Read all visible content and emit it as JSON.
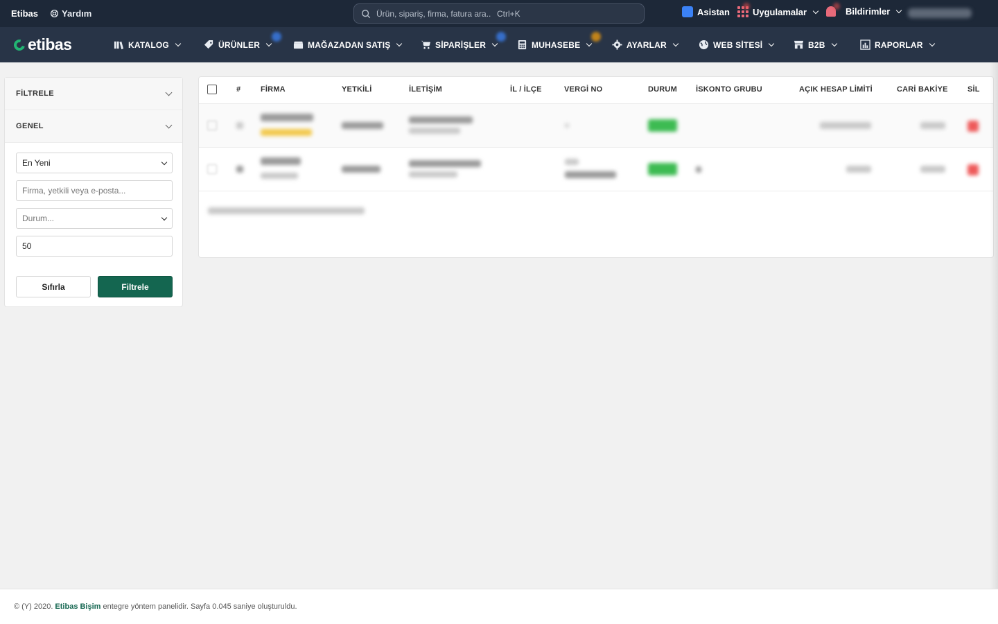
{
  "topbar": {
    "brand": "Etibas",
    "help_label": "Yardım",
    "search_placeholder": "Ürün, sipariş, firma, fatura ara...",
    "search_shortcut": "Ctrl+K",
    "assistant_label": "Asistan",
    "apps_label": "Uygulamalar",
    "notifications_label": "Bildirimler"
  },
  "navbar": {
    "logo": "etibas",
    "items": [
      {
        "label": "KATALOG",
        "icon": "books-icon"
      },
      {
        "label": "ÜRÜNLER",
        "icon": "tag-icon"
      },
      {
        "label": "MAĞAZADAN SATIŞ",
        "icon": "store-icon"
      },
      {
        "label": "SİPARİŞLER",
        "icon": "cart-icon"
      },
      {
        "label": "MUHASEBE",
        "icon": "calculator-icon"
      },
      {
        "label": "AYARLAR",
        "icon": "gear-icon"
      },
      {
        "label": "WEB SİTESİ",
        "icon": "globe-icon"
      },
      {
        "label": "B2B",
        "icon": "shop-icon"
      },
      {
        "label": "RAPORLAR",
        "icon": "chart-icon"
      }
    ]
  },
  "sidebar": {
    "filter_title": "FİLTRELE",
    "general_title": "GENEL",
    "sort_value": "En Yeni",
    "search_placeholder": "Firma, yetkili veya e-posta...",
    "status_placeholder": "Durum...",
    "limit_value": "50",
    "reset_label": "Sıfırla",
    "filter_label": "Filtrele"
  },
  "table": {
    "columns": [
      "#",
      "FİRMA",
      "YETKİLİ",
      "İLETİŞİM",
      "İL / İLÇE",
      "VERGİ NO",
      "DURUM",
      "İSKONTO GRUBU",
      "AÇIK HESAP LİMİTİ",
      "CARİ BAKİYE",
      "SİL"
    ]
  },
  "footer": {
    "prefix": "© (Y) 2020.",
    "company": "Etibas Bişim",
    "suffix": "entegre yöntem panelidir. Sayfa 0.045 saniye oluşturuldu."
  },
  "colors": {
    "topbar_bg": "#1d2838",
    "navbar_bg": "#283447",
    "accent_green": "#146650",
    "status_green": "#3dbb52",
    "delete_red": "#ee5a5a"
  }
}
